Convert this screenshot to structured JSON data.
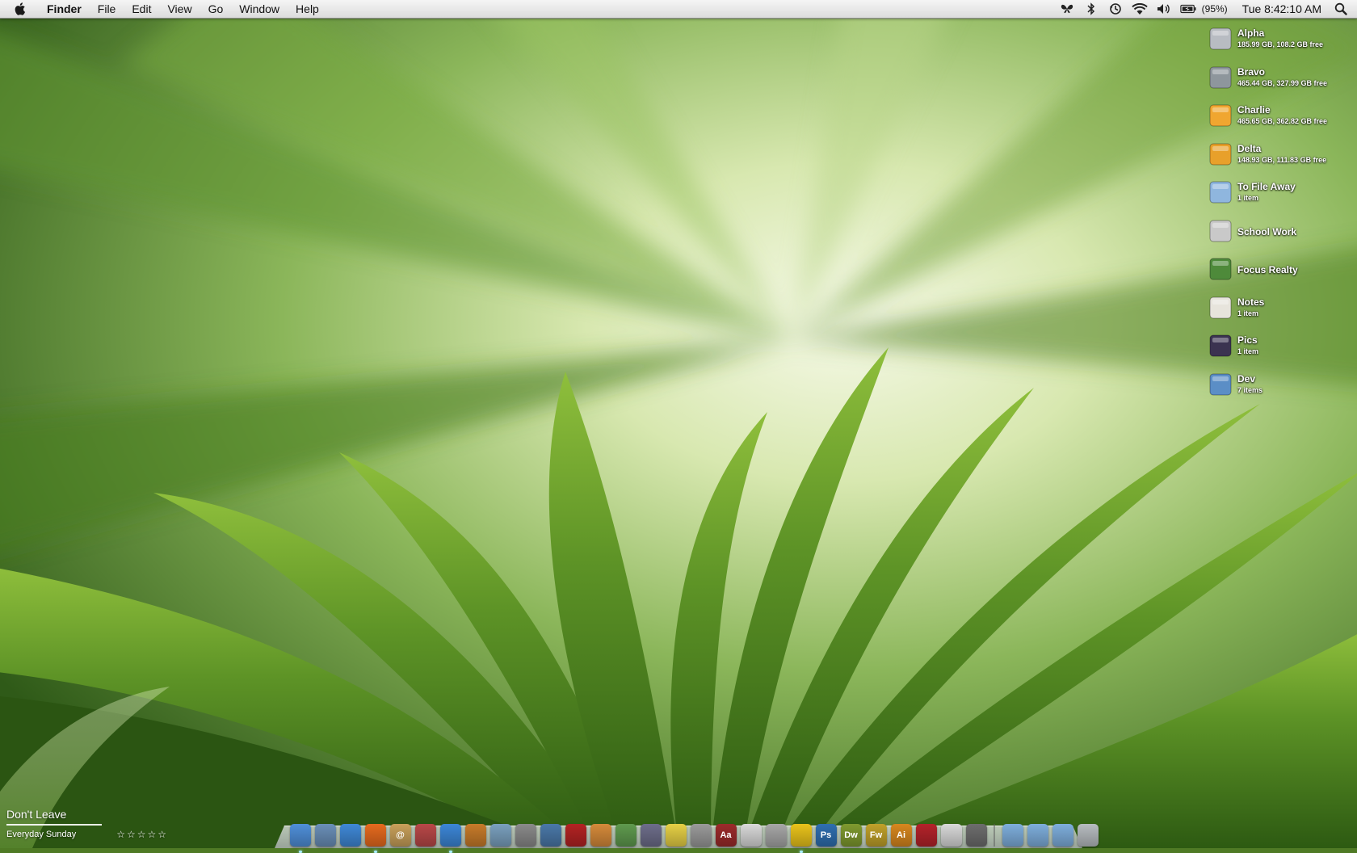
{
  "menubar": {
    "apple_icon": "apple-logo-icon",
    "app_name": "Finder",
    "menus": [
      "File",
      "Edit",
      "View",
      "Go",
      "Window",
      "Help"
    ],
    "status_icons": [
      "butterfly-icon",
      "bluetooth-icon",
      "time-machine-icon",
      "wifi-icon",
      "volume-icon",
      "battery-icon"
    ],
    "battery_percent": "(95%)",
    "clock": "Tue 8:42:10 AM",
    "spotlight_icon": "spotlight-search-icon"
  },
  "desktop_icons": [
    {
      "name": "Alpha",
      "sub": "185.99 GB, 108.2 GB free",
      "icon": "internal-drive-icon",
      "color": "#b8bcc2"
    },
    {
      "name": "Bravo",
      "sub": "465.44 GB, 327.99 GB free",
      "icon": "time-machine-drive-icon",
      "color": "#8e969c"
    },
    {
      "name": "Charlie",
      "sub": "465.65 GB, 362.82 GB free",
      "icon": "firewire-drive-icon",
      "color": "#f0a630"
    },
    {
      "name": "Delta",
      "sub": "148.93 GB, 111.83 GB free",
      "icon": "usb-drive-icon",
      "color": "#e8a02a"
    },
    {
      "name": "To File Away",
      "sub": "1 item",
      "icon": "folder-icon",
      "color": "#8fb6de"
    },
    {
      "name": "School Work",
      "sub": "",
      "icon": "alias-icon",
      "color": "#c9c9c9"
    },
    {
      "name": "Focus Realty",
      "sub": "",
      "icon": "alias-icon",
      "color": "#4e8a3a"
    },
    {
      "name": "Notes",
      "sub": "1 item",
      "icon": "notes-folder-icon",
      "color": "#e7e4dc"
    },
    {
      "name": "Pics",
      "sub": "1 item",
      "icon": "camera-folder-icon",
      "color": "#3b3350"
    },
    {
      "name": "Dev",
      "sub": "7 items",
      "icon": "blueprint-folder-icon",
      "color": "#5b8ec6"
    }
  ],
  "now_playing": {
    "title": "Don't Leave",
    "artist": "Everyday Sunday",
    "rating": "☆☆☆☆☆"
  },
  "dock": {
    "apps": [
      {
        "name": "finder-icon",
        "color": "#4f8fd9",
        "label": "",
        "running": true
      },
      {
        "name": "preview-icon",
        "color": "#6a8fb8",
        "label": "",
        "running": false
      },
      {
        "name": "safari-icon",
        "color": "#3f88d6",
        "label": "",
        "running": false
      },
      {
        "name": "firefox-icon",
        "color": "#e66a1e",
        "label": "",
        "running": true
      },
      {
        "name": "address-book-icon",
        "color": "#c8a05a",
        "label": "@",
        "running": false
      },
      {
        "name": "ical-icon",
        "color": "#b94848",
        "label": "",
        "running": false
      },
      {
        "name": "itunes-icon",
        "color": "#3c86d6",
        "label": "",
        "running": true
      },
      {
        "name": "garageband-icon",
        "color": "#c77b2a",
        "label": "",
        "running": false
      },
      {
        "name": "iphoto-icon",
        "color": "#7aa0be",
        "label": "",
        "running": false
      },
      {
        "name": "system-prefs-icon",
        "color": "#8a8a8a",
        "label": "",
        "running": false
      },
      {
        "name": "keychain-icon",
        "color": "#4a78a8",
        "label": "",
        "running": false
      },
      {
        "name": "photo-booth-icon",
        "color": "#b32323",
        "label": "",
        "running": false
      },
      {
        "name": "imovie-icon",
        "color": "#d58a3a",
        "label": "",
        "running": false
      },
      {
        "name": "activity-monitor-icon",
        "color": "#5f9a4e",
        "label": "",
        "running": false
      },
      {
        "name": "script-editor-icon",
        "color": "#6d6d8a",
        "label": "",
        "running": false
      },
      {
        "name": "stickies-icon",
        "color": "#e6d045",
        "label": "",
        "running": false
      },
      {
        "name": "calculator-icon",
        "color": "#9a9a9a",
        "label": "",
        "running": false
      },
      {
        "name": "dictionary-icon",
        "color": "#9c2b2b",
        "label": "Aa",
        "running": false
      },
      {
        "name": "textedit-icon",
        "color": "#d9d9d9",
        "label": "",
        "running": false
      },
      {
        "name": "terminal-icon",
        "color": "#a7a7a7",
        "label": "",
        "running": false
      },
      {
        "name": "cyberduck-icon",
        "color": "#e9c31b",
        "label": "",
        "running": true
      },
      {
        "name": "photoshop-icon",
        "color": "#2f6fb0",
        "label": "Ps",
        "running": false
      },
      {
        "name": "dreamweaver-icon",
        "color": "#7f9a2f",
        "label": "Dw",
        "running": false
      },
      {
        "name": "fireworks-icon",
        "color": "#c0a12a",
        "label": "Fw",
        "running": false
      },
      {
        "name": "illustrator-icon",
        "color": "#d7871e",
        "label": "Ai",
        "running": false
      },
      {
        "name": "flash-icon",
        "color": "#b4232a",
        "label": "",
        "running": false
      },
      {
        "name": "acrobat-icon",
        "color": "#d9d9d9",
        "label": "",
        "running": false
      },
      {
        "name": "disk-utility-icon",
        "color": "#6d6d6d",
        "label": "",
        "running": false
      }
    ],
    "folders": [
      {
        "name": "applications-folder-icon",
        "color": "#7eaedc"
      },
      {
        "name": "documents-folder-icon",
        "color": "#7eaedc"
      },
      {
        "name": "downloads-folder-icon",
        "color": "#7eaedc"
      },
      {
        "name": "trash-icon",
        "color": "#b7bcc0"
      }
    ]
  }
}
